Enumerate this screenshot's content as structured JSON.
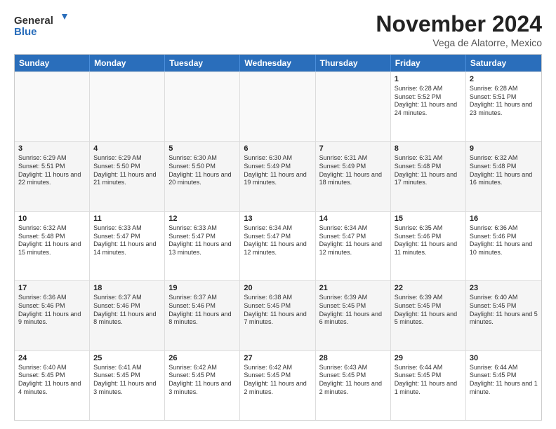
{
  "logo": {
    "line1": "General",
    "line2": "Blue"
  },
  "title": "November 2024",
  "subtitle": "Vega de Alatorre, Mexico",
  "days": [
    "Sunday",
    "Monday",
    "Tuesday",
    "Wednesday",
    "Thursday",
    "Friday",
    "Saturday"
  ],
  "rows": [
    [
      {
        "day": "",
        "info": "",
        "empty": true
      },
      {
        "day": "",
        "info": "",
        "empty": true
      },
      {
        "day": "",
        "info": "",
        "empty": true
      },
      {
        "day": "",
        "info": "",
        "empty": true
      },
      {
        "day": "",
        "info": "",
        "empty": true
      },
      {
        "day": "1",
        "info": "Sunrise: 6:28 AM\nSunset: 5:52 PM\nDaylight: 11 hours and 24 minutes.",
        "empty": false
      },
      {
        "day": "2",
        "info": "Sunrise: 6:28 AM\nSunset: 5:51 PM\nDaylight: 11 hours and 23 minutes.",
        "empty": false
      }
    ],
    [
      {
        "day": "3",
        "info": "Sunrise: 6:29 AM\nSunset: 5:51 PM\nDaylight: 11 hours and 22 minutes.",
        "empty": false
      },
      {
        "day": "4",
        "info": "Sunrise: 6:29 AM\nSunset: 5:50 PM\nDaylight: 11 hours and 21 minutes.",
        "empty": false
      },
      {
        "day": "5",
        "info": "Sunrise: 6:30 AM\nSunset: 5:50 PM\nDaylight: 11 hours and 20 minutes.",
        "empty": false
      },
      {
        "day": "6",
        "info": "Sunrise: 6:30 AM\nSunset: 5:49 PM\nDaylight: 11 hours and 19 minutes.",
        "empty": false
      },
      {
        "day": "7",
        "info": "Sunrise: 6:31 AM\nSunset: 5:49 PM\nDaylight: 11 hours and 18 minutes.",
        "empty": false
      },
      {
        "day": "8",
        "info": "Sunrise: 6:31 AM\nSunset: 5:48 PM\nDaylight: 11 hours and 17 minutes.",
        "empty": false
      },
      {
        "day": "9",
        "info": "Sunrise: 6:32 AM\nSunset: 5:48 PM\nDaylight: 11 hours and 16 minutes.",
        "empty": false
      }
    ],
    [
      {
        "day": "10",
        "info": "Sunrise: 6:32 AM\nSunset: 5:48 PM\nDaylight: 11 hours and 15 minutes.",
        "empty": false
      },
      {
        "day": "11",
        "info": "Sunrise: 6:33 AM\nSunset: 5:47 PM\nDaylight: 11 hours and 14 minutes.",
        "empty": false
      },
      {
        "day": "12",
        "info": "Sunrise: 6:33 AM\nSunset: 5:47 PM\nDaylight: 11 hours and 13 minutes.",
        "empty": false
      },
      {
        "day": "13",
        "info": "Sunrise: 6:34 AM\nSunset: 5:47 PM\nDaylight: 11 hours and 12 minutes.",
        "empty": false
      },
      {
        "day": "14",
        "info": "Sunrise: 6:34 AM\nSunset: 5:47 PM\nDaylight: 11 hours and 12 minutes.",
        "empty": false
      },
      {
        "day": "15",
        "info": "Sunrise: 6:35 AM\nSunset: 5:46 PM\nDaylight: 11 hours and 11 minutes.",
        "empty": false
      },
      {
        "day": "16",
        "info": "Sunrise: 6:36 AM\nSunset: 5:46 PM\nDaylight: 11 hours and 10 minutes.",
        "empty": false
      }
    ],
    [
      {
        "day": "17",
        "info": "Sunrise: 6:36 AM\nSunset: 5:46 PM\nDaylight: 11 hours and 9 minutes.",
        "empty": false
      },
      {
        "day": "18",
        "info": "Sunrise: 6:37 AM\nSunset: 5:46 PM\nDaylight: 11 hours and 8 minutes.",
        "empty": false
      },
      {
        "day": "19",
        "info": "Sunrise: 6:37 AM\nSunset: 5:46 PM\nDaylight: 11 hours and 8 minutes.",
        "empty": false
      },
      {
        "day": "20",
        "info": "Sunrise: 6:38 AM\nSunset: 5:45 PM\nDaylight: 11 hours and 7 minutes.",
        "empty": false
      },
      {
        "day": "21",
        "info": "Sunrise: 6:39 AM\nSunset: 5:45 PM\nDaylight: 11 hours and 6 minutes.",
        "empty": false
      },
      {
        "day": "22",
        "info": "Sunrise: 6:39 AM\nSunset: 5:45 PM\nDaylight: 11 hours and 5 minutes.",
        "empty": false
      },
      {
        "day": "23",
        "info": "Sunrise: 6:40 AM\nSunset: 5:45 PM\nDaylight: 11 hours and 5 minutes.",
        "empty": false
      }
    ],
    [
      {
        "day": "24",
        "info": "Sunrise: 6:40 AM\nSunset: 5:45 PM\nDaylight: 11 hours and 4 minutes.",
        "empty": false
      },
      {
        "day": "25",
        "info": "Sunrise: 6:41 AM\nSunset: 5:45 PM\nDaylight: 11 hours and 3 minutes.",
        "empty": false
      },
      {
        "day": "26",
        "info": "Sunrise: 6:42 AM\nSunset: 5:45 PM\nDaylight: 11 hours and 3 minutes.",
        "empty": false
      },
      {
        "day": "27",
        "info": "Sunrise: 6:42 AM\nSunset: 5:45 PM\nDaylight: 11 hours and 2 minutes.",
        "empty": false
      },
      {
        "day": "28",
        "info": "Sunrise: 6:43 AM\nSunset: 5:45 PM\nDaylight: 11 hours and 2 minutes.",
        "empty": false
      },
      {
        "day": "29",
        "info": "Sunrise: 6:44 AM\nSunset: 5:45 PM\nDaylight: 11 hours and 1 minute.",
        "empty": false
      },
      {
        "day": "30",
        "info": "Sunrise: 6:44 AM\nSunset: 5:45 PM\nDaylight: 11 hours and 1 minute.",
        "empty": false
      }
    ]
  ]
}
